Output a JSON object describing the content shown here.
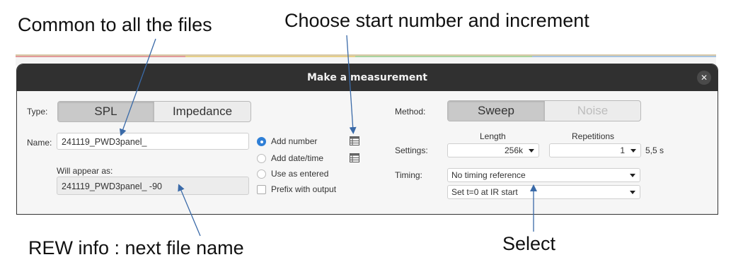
{
  "annotations": {
    "common": "Common to all the files",
    "start": "Choose start number and increment",
    "rew_info": "REW info : next file name",
    "select": "Select"
  },
  "dialog": {
    "title": "Make a measurement",
    "close_glyph": "✕",
    "type_label": "Type:",
    "type_options": [
      "SPL",
      "Impedance"
    ],
    "type_selected": "SPL",
    "name_label": "Name:",
    "name_value": "241119_PWD3panel_",
    "will_appear_label": "Will appear as:",
    "will_appear_value": "241119_PWD3panel_ -90",
    "naming_options": [
      {
        "label": "Add number",
        "selected": true,
        "icon": "table-icon"
      },
      {
        "label": "Add date/time",
        "selected": false,
        "icon": "table-icon"
      },
      {
        "label": "Use as entered",
        "selected": false
      }
    ],
    "prefix_label": "Prefix with output",
    "prefix_checked": false,
    "method_label": "Method:",
    "method_options": [
      "Sweep",
      "Noise"
    ],
    "method_selected": "Sweep",
    "settings_label": "Settings:",
    "length_label": "Length",
    "length_value": "256k",
    "repetitions_label": "Repetitions",
    "repetitions_value": "1",
    "duration": "5,5 s",
    "timing_label": "Timing:",
    "timing_reference": "No timing reference",
    "t0_option": "Set t=0 at IR start"
  },
  "colors": {
    "titlebar": "#303030",
    "radio_selected": "#2f7fd6",
    "arrow": "#3a6aa8"
  }
}
